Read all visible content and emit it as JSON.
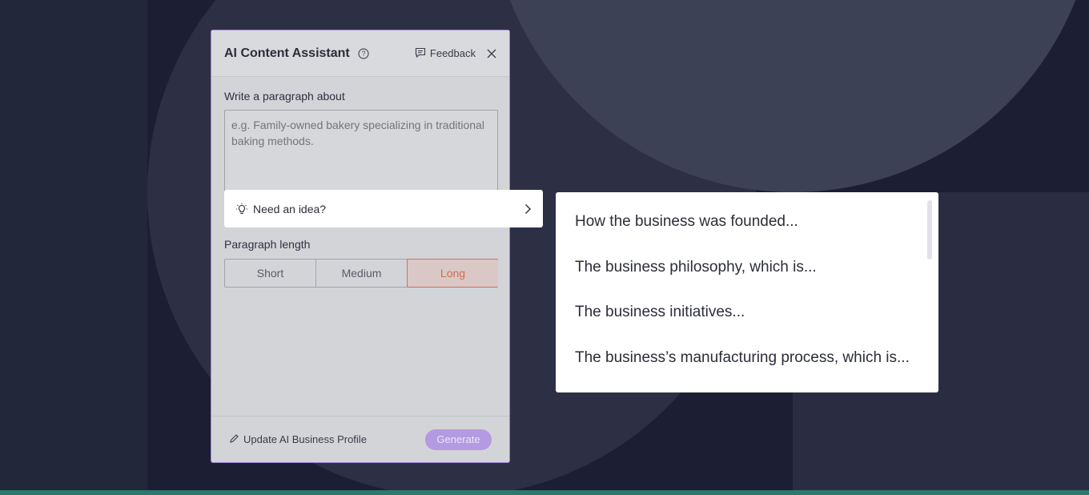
{
  "panel": {
    "title": "AI Content Assistant",
    "feedback_label": "Feedback",
    "prompt_label": "Write a paragraph about",
    "textarea_placeholder": "e.g. Family-owned bakery specializing in traditional baking methods.",
    "idea_label": "Need an idea?",
    "length_label": "Paragraph length",
    "length_options": [
      "Short",
      "Medium",
      "Long"
    ],
    "length_selected": "Long",
    "update_profile_label": "Update AI Business Profile",
    "generate_label": "Generate"
  },
  "suggestions": [
    "How the business was founded...",
    "The business philosophy, which is...",
    "The business initiatives...",
    "The business’s manufacturing process, which is..."
  ],
  "colors": {
    "accent_purple": "#b49ae0",
    "selected_orange": "#d66a52",
    "background": "#1c1f33"
  }
}
